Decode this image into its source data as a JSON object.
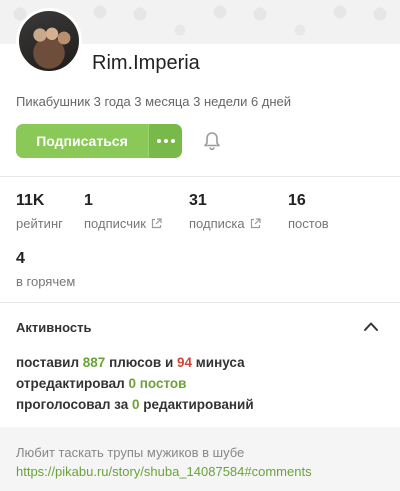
{
  "profile": {
    "username": "Rim.Imperia",
    "since": "Пикабушник 3 года 3 месяца 3 недели 6 дней",
    "subscribe_label": "Подписаться"
  },
  "stats": {
    "rating": {
      "value": "11K",
      "label": "рейтинг"
    },
    "followers": {
      "value": "1",
      "label": "подписчик"
    },
    "following": {
      "value": "31",
      "label": "подписка"
    },
    "posts": {
      "value": "16",
      "label": "постов"
    },
    "hot": {
      "value": "4",
      "label": "в горячем"
    }
  },
  "activity": {
    "title": "Активность",
    "line1_a": "поставил ",
    "pluses": "887",
    "line1_b": " плюсов и ",
    "minuses": "94",
    "line1_c": " минуса",
    "line2_a": "отредактировал ",
    "line2_b": "0 постов",
    "line3_a": "проголосовал за ",
    "line3_b": "0",
    "line3_c": " редактирований"
  },
  "about": {
    "text": "Любит таскать трупы мужиков в шубе",
    "link": "https://pikabu.ru/story/shuba_14087584#comments"
  },
  "colors": {
    "accent": "#8ac858",
    "positive": "#6aa33b",
    "negative": "#d0473a"
  },
  "icons": [
    "more-icon",
    "bell-icon",
    "external-link-icon",
    "chevron-up-icon"
  ]
}
